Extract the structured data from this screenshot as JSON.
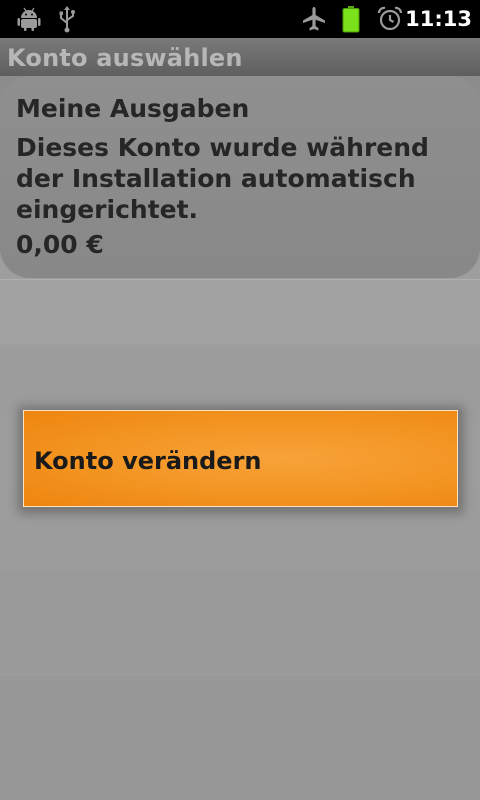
{
  "statusbar": {
    "time": "11:13",
    "icons": [
      "android-debug-icon",
      "usb-icon",
      "airplane-mode-icon",
      "battery-icon",
      "alarm-icon"
    ],
    "battery_color": "#7be11a"
  },
  "titlebar": {
    "title": "Konto auswählen"
  },
  "account": {
    "name": "Meine Ausgaben",
    "description": "Dieses Konto wurde während der Installation automatisch eingerichtet.",
    "amount": "0,00 €"
  },
  "action": {
    "label": "Konto verändern",
    "color": "#f39421"
  }
}
